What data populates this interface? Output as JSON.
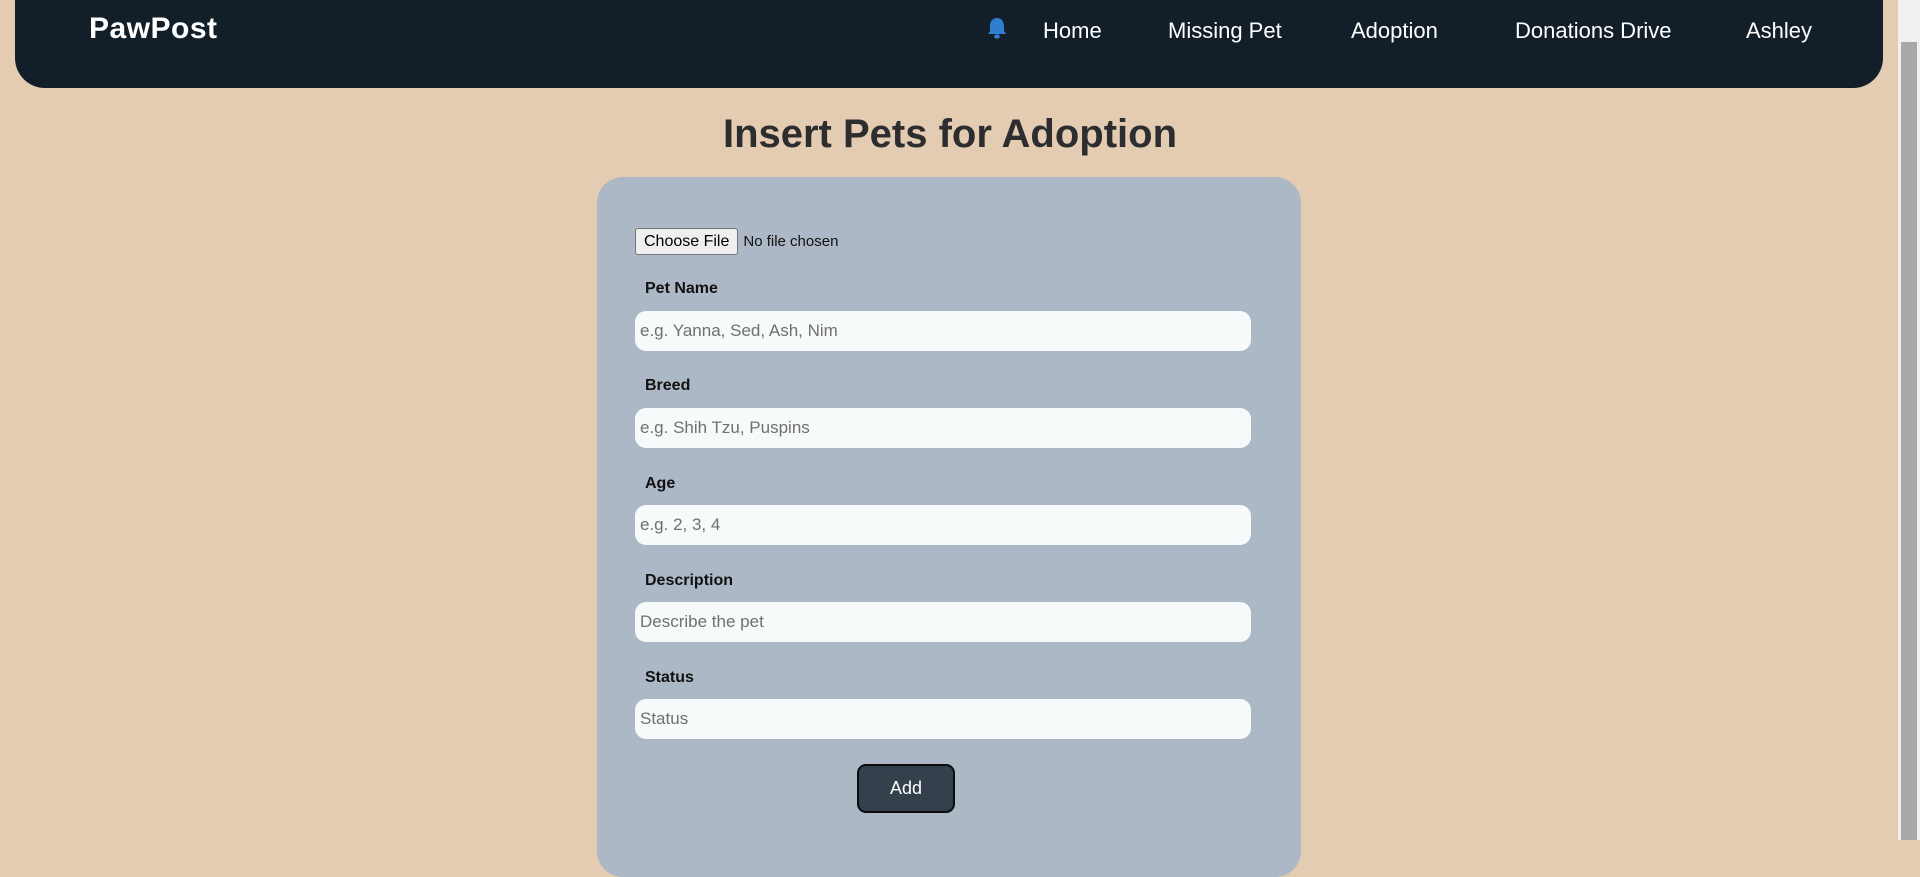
{
  "nav": {
    "brand": "PawPost",
    "items": [
      {
        "label": "Home"
      },
      {
        "label": "Missing Pet"
      },
      {
        "label": "Adoption"
      },
      {
        "label": "Donations Drive"
      },
      {
        "label": "Ashley"
      }
    ],
    "bell_icon": "bell-icon",
    "bell_color": "#2f7fd0"
  },
  "page": {
    "title": "Insert Pets for Adoption"
  },
  "form": {
    "file_button": "Choose File",
    "file_status": "No file chosen",
    "fields": [
      {
        "label": "Pet Name",
        "placeholder": "e.g. Yanna, Sed, Ash, Nim",
        "value": ""
      },
      {
        "label": "Breed",
        "placeholder": "e.g. Shih Tzu, Puspins",
        "value": ""
      },
      {
        "label": "Age",
        "placeholder": "e.g. 2, 3, 4",
        "value": ""
      },
      {
        "label": "Description",
        "placeholder": "Describe the pet",
        "value": ""
      },
      {
        "label": "Status",
        "placeholder": "Status",
        "value": ""
      }
    ],
    "submit_label": "Add"
  },
  "colors": {
    "background": "#e3ccb1",
    "navbar": "#121f29",
    "card": "#adb8c6",
    "button": "#34404c"
  }
}
